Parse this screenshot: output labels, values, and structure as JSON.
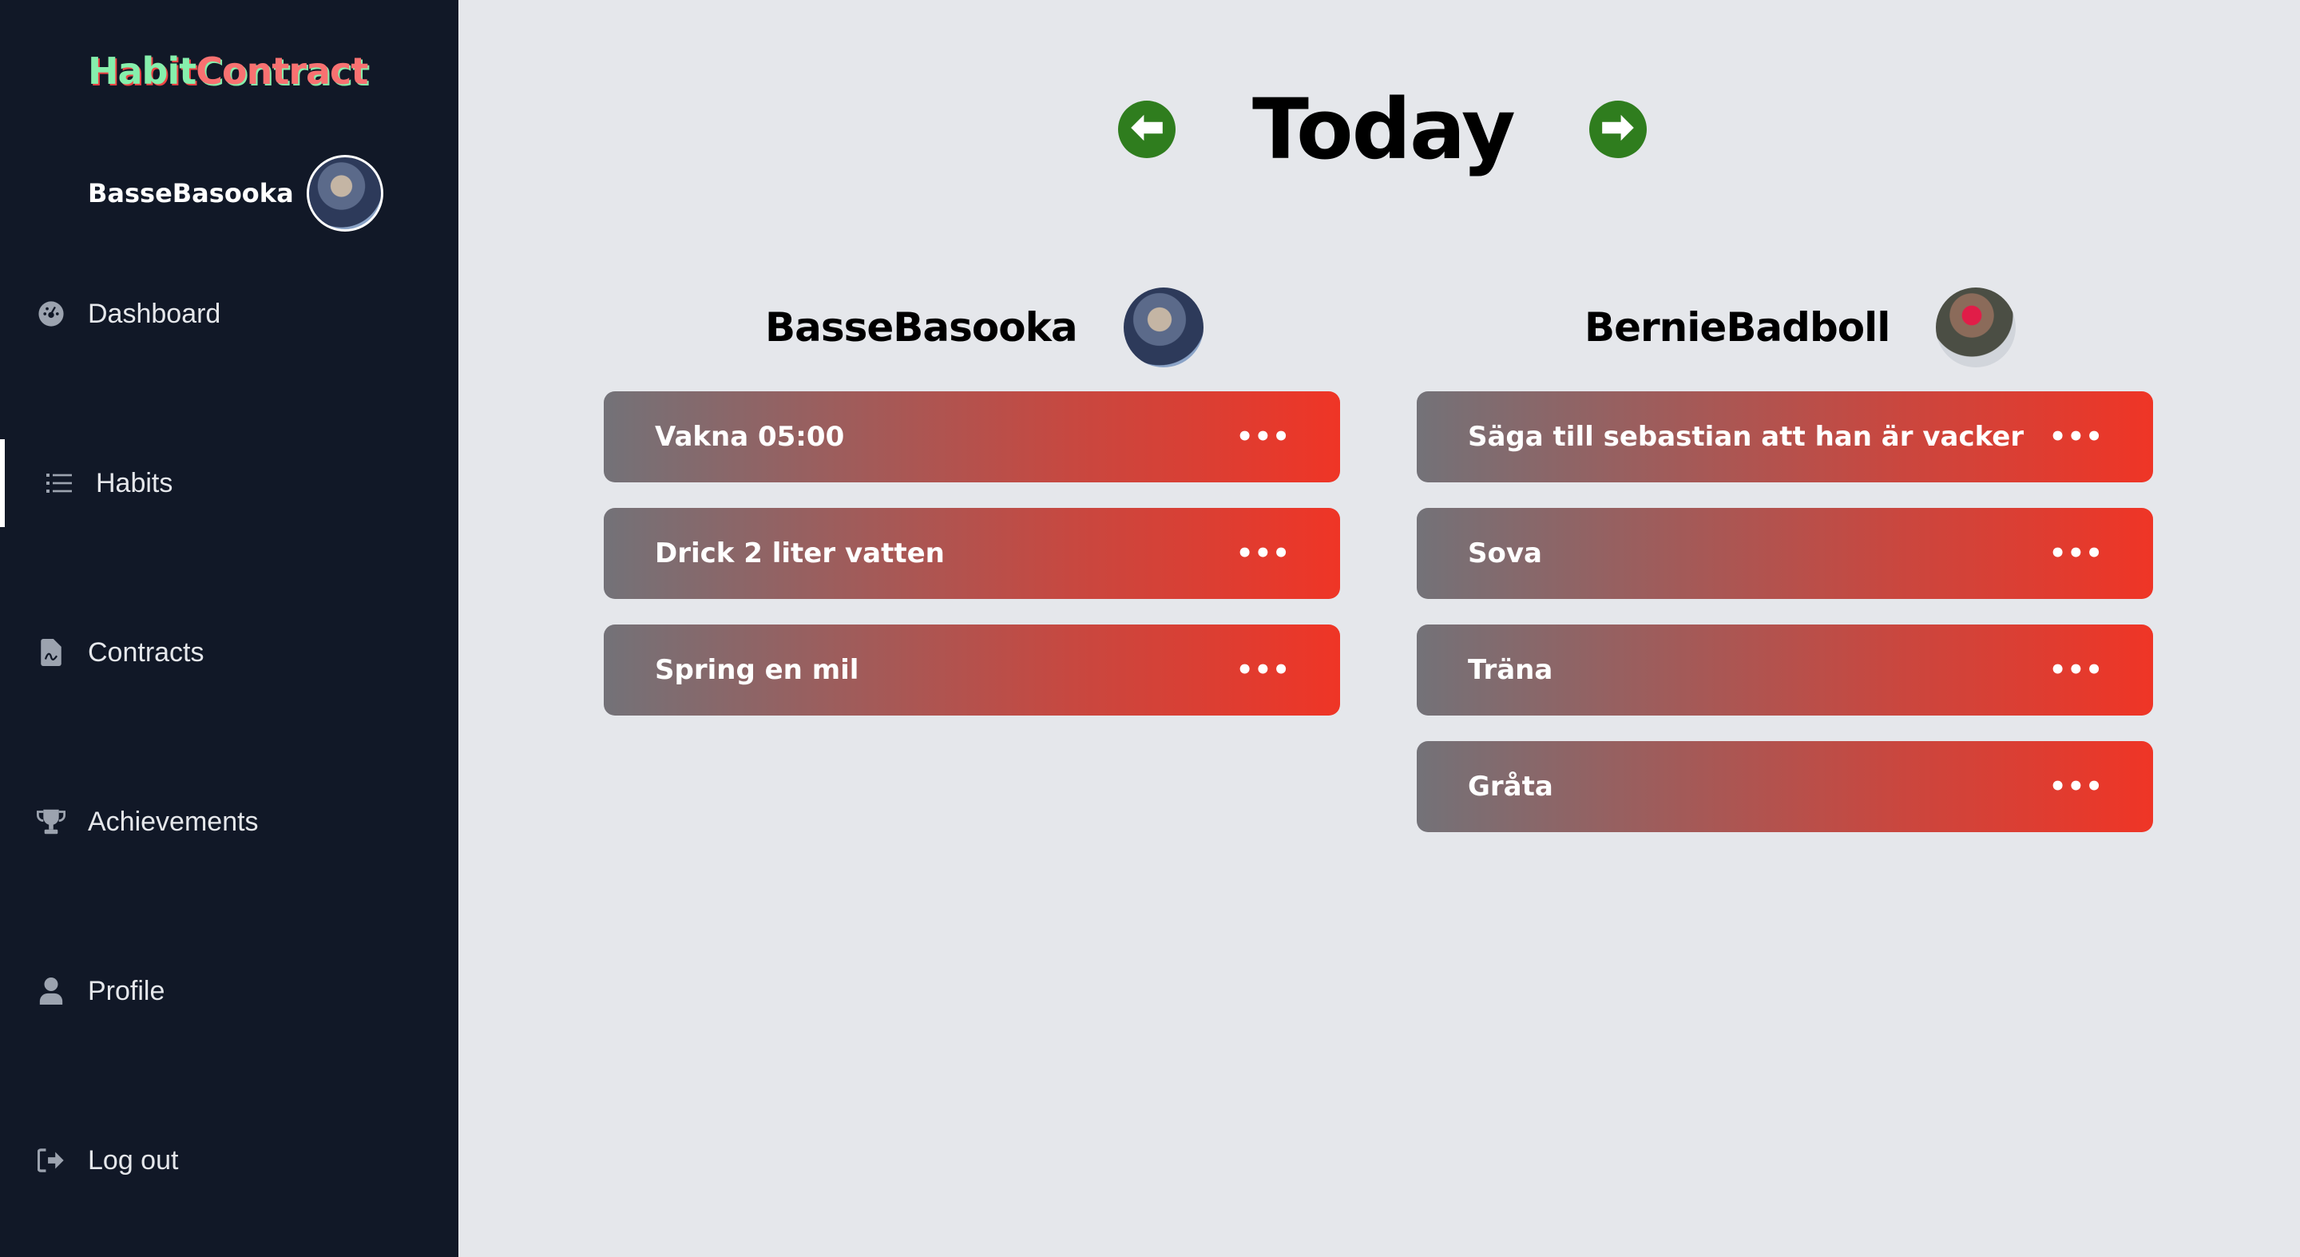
{
  "app": {
    "logo_part1": "Habit",
    "logo_part2": "Contract",
    "current_user": "BasseBasooka"
  },
  "sidebar": {
    "items": [
      {
        "label": "Dashboard",
        "icon": "dashboard-icon"
      },
      {
        "label": "Habits",
        "icon": "list-icon",
        "active": true
      },
      {
        "label": "Contracts",
        "icon": "contract-file-icon"
      },
      {
        "label": "Achievements",
        "icon": "trophy-icon"
      },
      {
        "label": "Profile",
        "icon": "user-icon"
      },
      {
        "label": "Log out",
        "icon": "logout-icon"
      }
    ]
  },
  "header": {
    "title": "Today",
    "prev_icon": "arrow-left-icon",
    "next_icon": "arrow-right-icon"
  },
  "columns": [
    {
      "user": "BasseBasooka",
      "habits": [
        "Vakna 05:00",
        "Drick 2 liter vatten",
        "Spring en mil"
      ]
    },
    {
      "user": "BernieBadboll",
      "habits": [
        "Säga till sebastian att han är vacker",
        "Sova",
        "Träna",
        "Gråta"
      ]
    }
  ],
  "colors": {
    "sidebar_bg": "#111827",
    "main_bg": "#e5e7eb",
    "arrow_green": "#2f7d1e",
    "card_start": "#737278",
    "card_end": "#ef3526"
  }
}
